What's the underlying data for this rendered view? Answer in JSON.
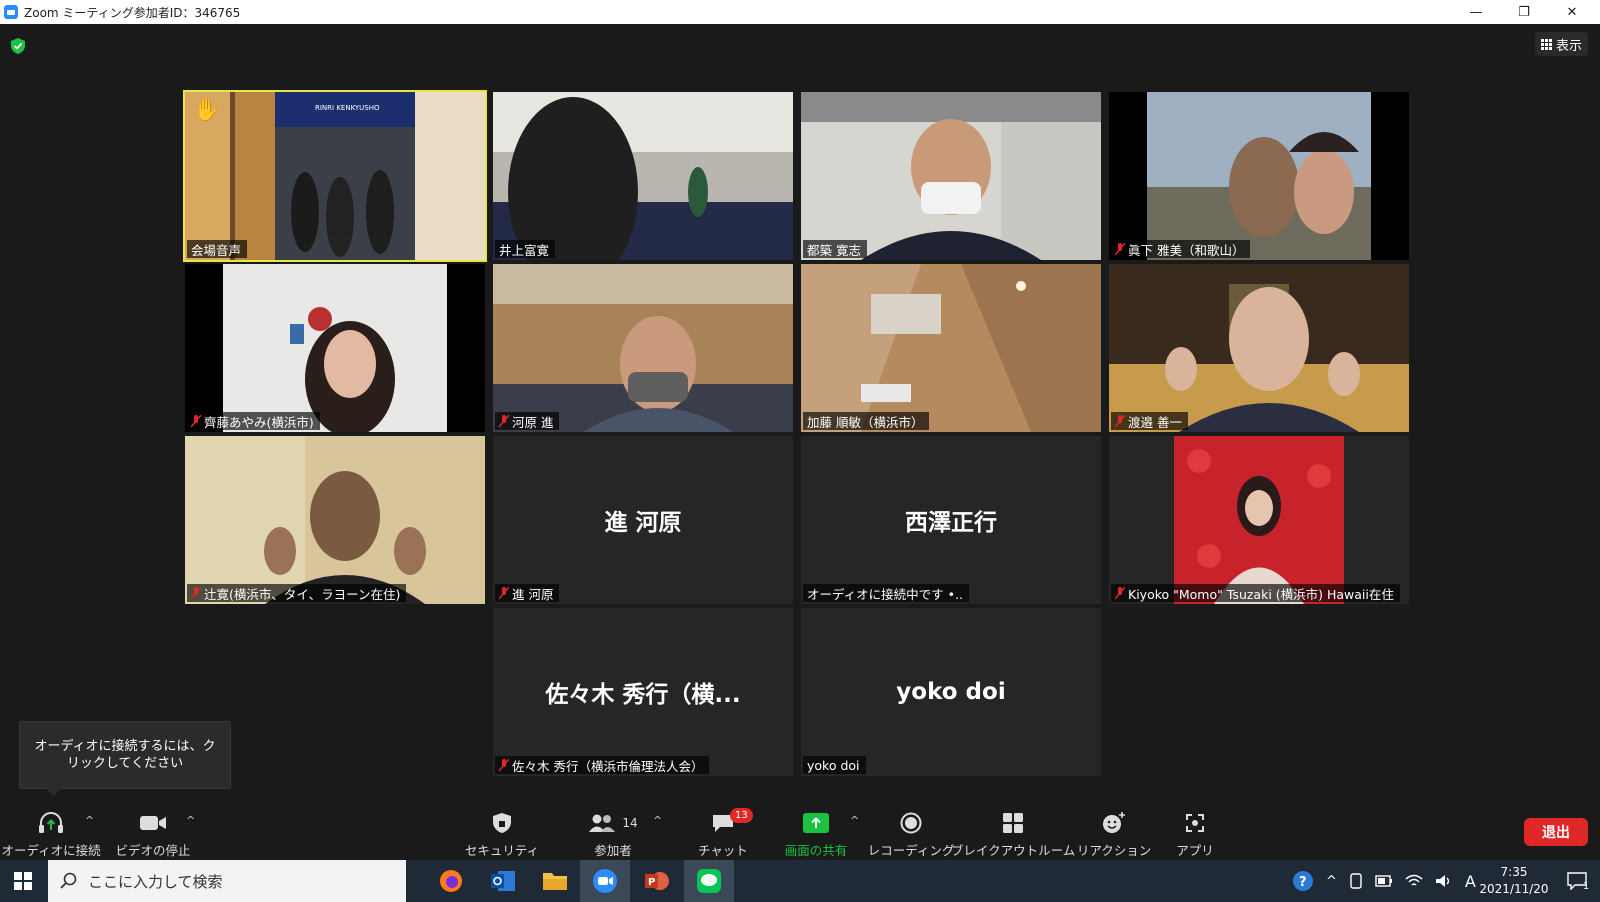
{
  "window": {
    "title": "Zoom ミーティング参加者ID：346765",
    "minimize": "—",
    "maximize": "❐",
    "close": "✕"
  },
  "view_button": {
    "label": "表示"
  },
  "tiles": [
    {
      "name": "会場音声",
      "muted": false,
      "raised_hand": true
    },
    {
      "name": "井上富寛",
      "muted": false
    },
    {
      "name": "都築 寛志",
      "muted": false
    },
    {
      "name": "眞下 雅美（和歌山）",
      "muted": true
    },
    {
      "name": "齊藤あやみ(横浜市)",
      "muted": true
    },
    {
      "name": "河原 進",
      "muted": true
    },
    {
      "name": "加藤 順敏（横浜市）",
      "muted": false
    },
    {
      "name": "渡邉 善一",
      "muted": true
    },
    {
      "name": "辻寛(横浜市、タイ、ラヨーン在住)",
      "muted": true
    },
    {
      "name": "進 河原",
      "muted": true,
      "display": "進 河原"
    },
    {
      "name": "オーディオに接続中です •..",
      "muted": false,
      "display": "西澤正行"
    },
    {
      "name": "Kiyoko \"Momo\" Tsuzaki (横浜市) Hawaii在住",
      "muted": true
    },
    {
      "name": "佐々木 秀行（横浜市倫理法人会）",
      "muted": true,
      "display": "佐々木 秀行（横..."
    },
    {
      "name": "yoko doi",
      "muted": false,
      "display": "yoko doi"
    }
  ],
  "tile_scene_text": "RINRI KENKYUSHO",
  "tooltip": {
    "line1": "オーディオに接続するには、ク",
    "line2": "リックしてください"
  },
  "toolbar": {
    "audio": "オーディオに接続",
    "video": "ビデオの停止",
    "security": "セキュリティ",
    "participants": "参加者",
    "participants_count": "14",
    "chat": "チャット",
    "chat_badge": "13",
    "share": "画面の共有",
    "record": "レコーディング",
    "breakout": "ブレイクアウトルーム",
    "reactions": "リアクション",
    "apps": "アプリ",
    "leave": "退出"
  },
  "taskbar": {
    "search_placeholder": "ここに入力して検索",
    "time": "7:35",
    "date": "2021/11/20",
    "ime": "A",
    "notifications": "1"
  },
  "colors": {
    "share_green": "#1bc244",
    "leave_red": "#e02828",
    "active_tile": "#e6e84a"
  }
}
